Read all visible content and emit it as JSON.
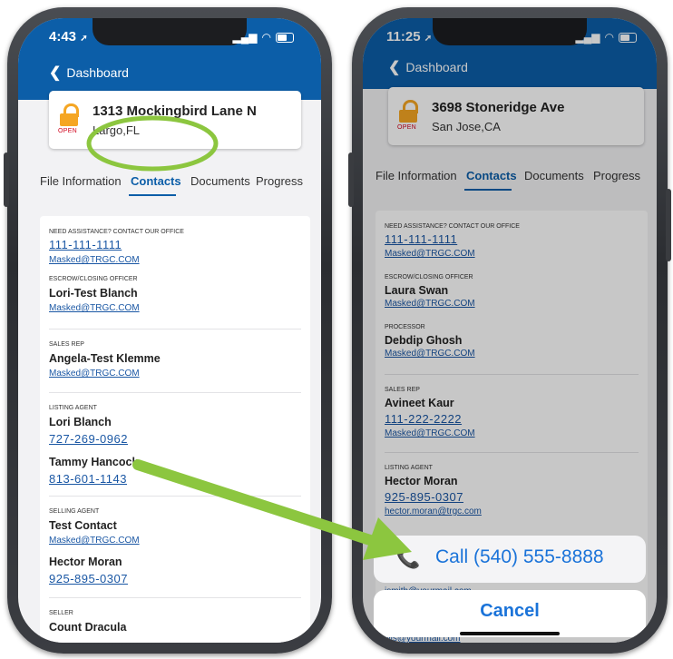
{
  "left": {
    "status": {
      "time": "4:43"
    },
    "nav": {
      "back_label": "Dashboard"
    },
    "card": {
      "lock_label": "OPEN",
      "address": "1313 Mockingbird Lane N",
      "city": "Largo,FL"
    },
    "tabs": [
      "File Information",
      "Contacts",
      "Documents",
      "Progress"
    ],
    "contacts": {
      "assist_label": "NEED ASSISTANCE? CONTACT OUR OFFICE",
      "assist_phone": "111-111-1111",
      "assist_email": "Masked@TRGC.COM",
      "escrow_label": "ESCROW/CLOSING OFFICER",
      "escrow_name": "Lori-Test Blanch",
      "escrow_email": "Masked@TRGC.COM",
      "sales_label": "SALES REP",
      "sales_name": "Angela-Test Klemme",
      "sales_email": "Masked@TRGC.COM",
      "listing_label": "LISTING AGENT",
      "listing1_name": "Lori Blanch",
      "listing1_phone": "727-269-0962",
      "listing2_name": "Tammy Hancock",
      "listing2_phone": "813-601-1143",
      "selling_label": "SELLING AGENT",
      "selling1_name": "Test Contact",
      "selling1_email": "Masked@TRGC.COM",
      "selling2_name": "Hector Moran",
      "selling2_phone": "925-895-0307",
      "seller_label": "SELLER",
      "seller_name": "Count Dracula"
    }
  },
  "right": {
    "status": {
      "time": "11:25"
    },
    "nav": {
      "back_label": "Dashboard"
    },
    "card": {
      "lock_label": "OPEN",
      "address": "3698 Stoneridge Ave",
      "city": "San Jose,CA"
    },
    "tabs": [
      "File Information",
      "Contacts",
      "Documents",
      "Progress"
    ],
    "contacts": {
      "assist_label": "NEED ASSISTANCE? CONTACT OUR OFFICE",
      "assist_phone": "111-111-1111",
      "assist_email": "Masked@TRGC.COM",
      "escrow_label": "ESCROW/CLOSING OFFICER",
      "escrow_name": "Laura Swan",
      "escrow_email": "Masked@TRGC.COM",
      "processor_label": "PROCESSOR",
      "processor_name": "Debdip Ghosh",
      "processor_email": "Masked@TRGC.COM",
      "sales_label": "SALES REP",
      "sales_name": "Avineet Kaur",
      "sales_phone": "111-222-2222",
      "sales_email": "Masked@TRGC.COM",
      "listing_label": "LISTING AGENT",
      "listing_name": "Hector Moran",
      "listing_phone": "925-895-0307",
      "listing_email": "hector.moran@trgc.com",
      "peek1_email": "jsmith@yourmail.com",
      "peek2_email": "jills@yourmail.com"
    },
    "action_sheet": {
      "call_label": "Call (540) 555-8888",
      "cancel_label": "Cancel"
    }
  },
  "annotations": {
    "highlight_color": "#8cc63f",
    "arrow_color": "#8cc63f"
  },
  "colors": {
    "header_blue": "#0c5ea8",
    "link_blue": "#1a57a4",
    "lock_orange": "#f5a623",
    "ios_blue": "#1a73d9"
  }
}
